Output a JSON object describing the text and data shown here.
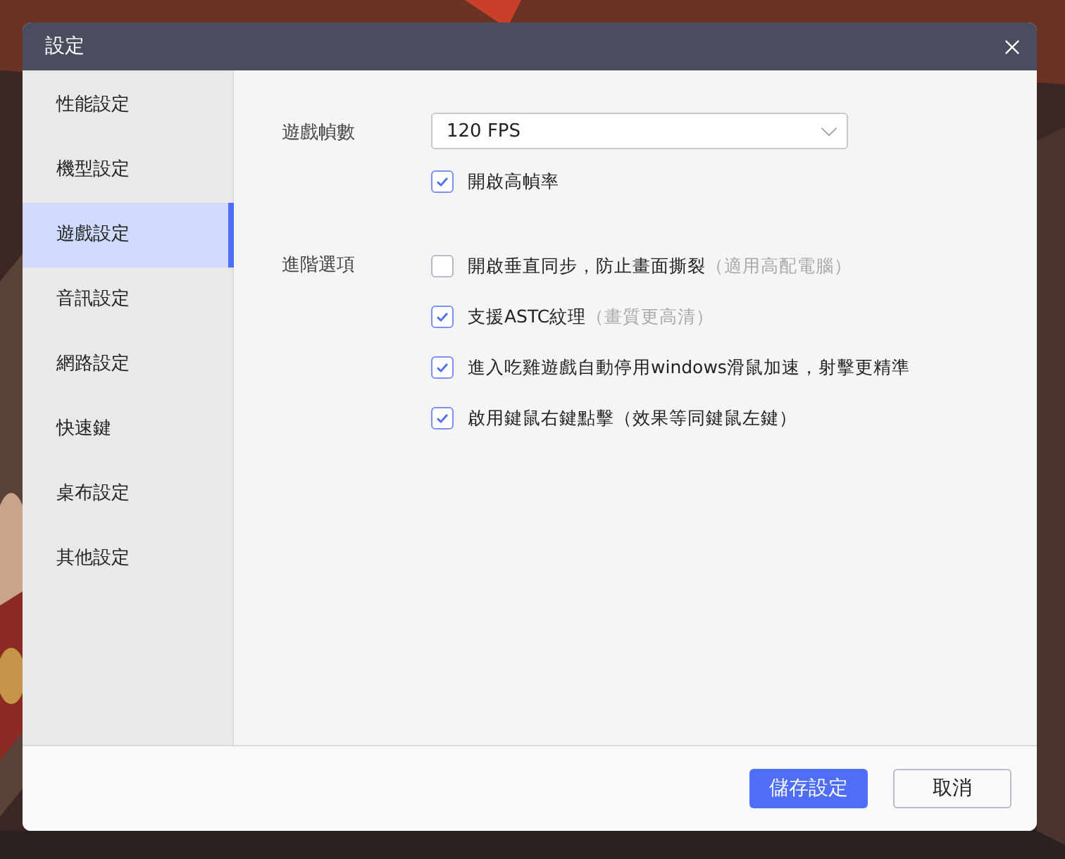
{
  "dialog": {
    "title": "設定"
  },
  "sidebar": {
    "items": [
      {
        "label": "性能設定",
        "selected": false
      },
      {
        "label": "機型設定",
        "selected": false
      },
      {
        "label": "遊戲設定",
        "selected": true
      },
      {
        "label": "音訊設定",
        "selected": false
      },
      {
        "label": "網路設定",
        "selected": false
      },
      {
        "label": "快速鍵",
        "selected": false
      },
      {
        "label": "桌布設定",
        "selected": false
      },
      {
        "label": "其他設定",
        "selected": false
      }
    ]
  },
  "frame_rate": {
    "label": "遊戲幀數",
    "value": "120 FPS",
    "options": [
      {
        "label": "開啟高幀率",
        "checked": true
      }
    ]
  },
  "advanced": {
    "label": "進階選項",
    "options": [
      {
        "label": "開啟垂直同步，防止畫面撕裂",
        "note": "（適用高配電腦）",
        "checked": false
      },
      {
        "label": "支援ASTC紋理",
        "note": "（畫質更高清）",
        "checked": true
      },
      {
        "label": "進入吃雞遊戲自動停用windows滑鼠加速，射擊更精準",
        "checked": true
      },
      {
        "label": "啟用鍵鼠右鍵點擊（效果等同鍵鼠左鍵）",
        "checked": true
      }
    ]
  },
  "buttons": [
    {
      "label": "儲存設定",
      "kind": "primary"
    },
    {
      "label": "取消",
      "kind": "secondary"
    }
  ]
}
